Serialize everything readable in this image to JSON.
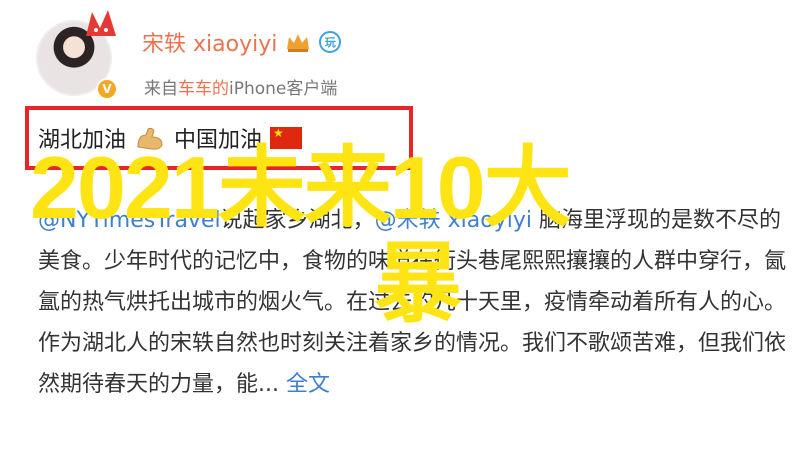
{
  "user": {
    "name": "宋轶 xiaoyiyi",
    "source_prefix": "来自",
    "source_app": "车车的",
    "source_device": "iPhone客户端",
    "level_badge": "玩",
    "verify_badge": "V"
  },
  "post": {
    "highlight_a": "湖北加油",
    "highlight_b": "中国加油",
    "mention_a": "@NYTimesTravel",
    "text_1": "说起家乡湖北，",
    "mention_b": "@宋轶 xiaoyiyi",
    "text_2": " 脑海里浮现的是数不尽的美食。少年时代的记忆中，食物的味道在街头巷尾熙熙攘攘的人群中穿行，氤氲的热气烘托出城市的烟火气。在过去的几十天里，疫情牵动着所有人的心。作为湖北人的宋轶自然也时刻关注着家乡的情况。我们不歌颂苦难，但我们依然期待春天的力量，能...",
    "more_label": "全文"
  },
  "overlay": {
    "line1": "2021未来10大",
    "line2": "暴"
  },
  "colors": {
    "name": "#eb7350",
    "link": "#3f7fcf",
    "frame": "#e8262a",
    "overlay": "#ffe414"
  },
  "icons": [
    "crown-icon",
    "flexed-arm-icon",
    "china-flag-icon"
  ]
}
